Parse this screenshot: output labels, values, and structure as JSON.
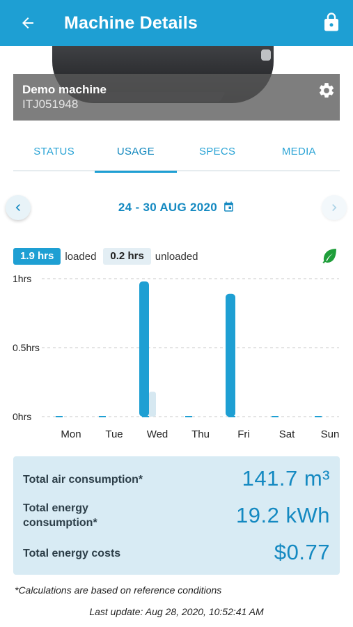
{
  "header": {
    "title": "Machine Details"
  },
  "machine": {
    "name": "Demo machine",
    "serial": "ITJ051948"
  },
  "tabs": [
    {
      "label": "STATUS",
      "active": false
    },
    {
      "label": "USAGE",
      "active": true
    },
    {
      "label": "SPECS",
      "active": false
    },
    {
      "label": "MEDIA",
      "active": false
    }
  ],
  "date_range": "24 - 30 AUG 2020",
  "legend": {
    "loaded_value": "1.9 hrs",
    "loaded_label": "loaded",
    "unloaded_value": "0.2 hrs",
    "unloaded_label": "unloaded"
  },
  "colors": {
    "accent": "#1e9fd3",
    "loaded": "#1e9fd3",
    "unloaded": "#d6e8f1",
    "leaf": "#1f9e3a"
  },
  "icons": [
    "arrow-back-icon",
    "lock-icon",
    "gear-icon",
    "chevron-left-icon",
    "chevron-right-icon",
    "calendar-icon",
    "leaf-icon"
  ],
  "chart_data": {
    "type": "bar",
    "categories": [
      "Mon",
      "Tue",
      "Wed",
      "Thu",
      "Fri",
      "Sat",
      "Sun"
    ],
    "series": [
      {
        "name": "loaded",
        "values": [
          0,
          0,
          0.98,
          0,
          0.89,
          0,
          0
        ]
      },
      {
        "name": "unloaded",
        "values": [
          0,
          0,
          0.18,
          0,
          0.01,
          0,
          0
        ]
      }
    ],
    "yticks": [
      {
        "value": 1,
        "label": "1hrs"
      },
      {
        "value": 0.5,
        "label": "0.5hrs"
      },
      {
        "value": 0,
        "label": "0hrs"
      }
    ],
    "ylim": [
      0,
      1
    ],
    "grid": true
  },
  "summary": [
    {
      "label": "Total air consumption*",
      "value": "141.7 m³"
    },
    {
      "label": "Total energy consumption*",
      "value": "19.2 kWh"
    },
    {
      "label": "Total energy costs",
      "value": "$0.77"
    }
  ],
  "footnote": "*Calculations are based on reference conditions",
  "last_update": "Last update: Aug 28, 2020, 10:52:41 AM"
}
